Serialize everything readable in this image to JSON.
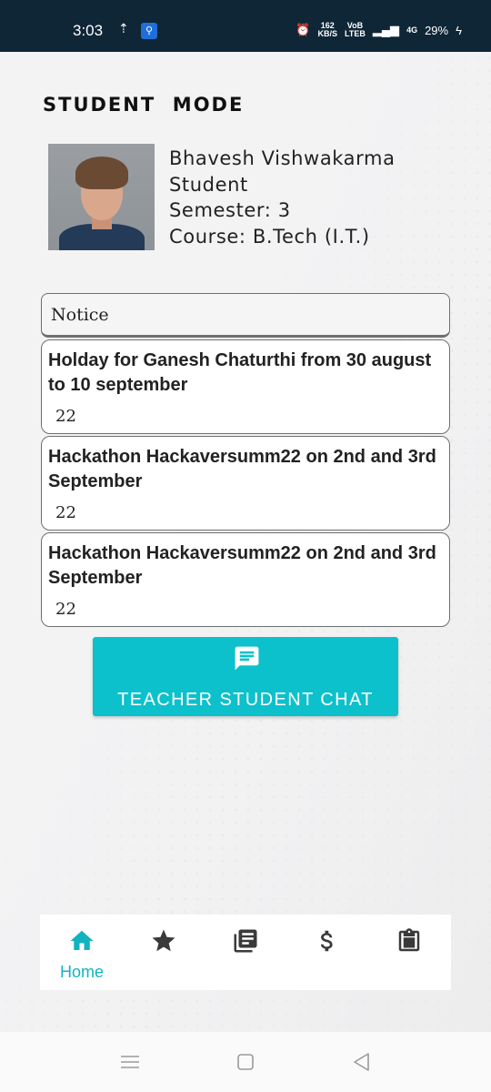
{
  "status_bar": {
    "time": "3:03",
    "speed_value": "162",
    "speed_unit": "KB/S",
    "volte_top": "VoB",
    "volte_bottom": "LTEB",
    "network": "4G",
    "battery": "29%"
  },
  "header": {
    "title": "STUDENT  MODE"
  },
  "profile": {
    "name": "Bhavesh Vishwakarma",
    "role": "Student",
    "semester": "Semester: 3",
    "course": "Course: B.Tech (I.T.)"
  },
  "notice": {
    "header": "Notice",
    "items": [
      {
        "title": "Holday for Ganesh Chaturthi from 30 august to 10 september",
        "year": "22"
      },
      {
        "title": "Hackathon Hackaversumm22 on 2nd and 3rd September",
        "year": "22"
      },
      {
        "title": "Hackathon Hackaversumm22 on 2nd and 3rd September",
        "year": "22"
      }
    ]
  },
  "chat_button": {
    "label": "TEACHER STUDENT CHAT",
    "icon": "chat-icon"
  },
  "bottom_nav": {
    "items": [
      {
        "label": "Home",
        "icon": "home-icon",
        "active": true
      },
      {
        "label": "",
        "icon": "star-icon"
      },
      {
        "label": "",
        "icon": "library-books-icon"
      },
      {
        "label": "",
        "icon": "dollar-icon"
      },
      {
        "label": "",
        "icon": "clipboard-icon"
      }
    ]
  },
  "colors": {
    "accent": "#0cc1cb",
    "status_bar": "#0f2637",
    "active_nav": "#12b3bf",
    "icon_dark": "#3a3a3a"
  }
}
